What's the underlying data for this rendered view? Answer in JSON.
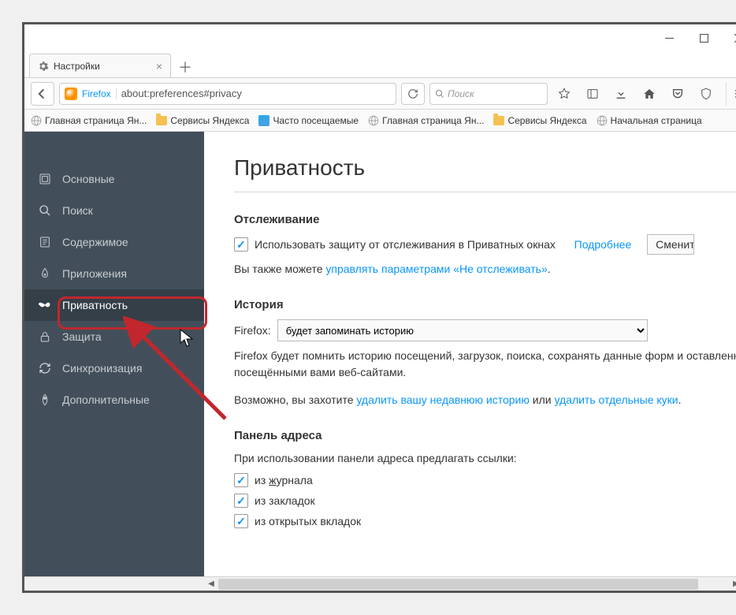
{
  "window": {
    "tab_title": "Настройки"
  },
  "toolbar": {
    "firefox_label": "Firefox",
    "url": "about:preferences#privacy",
    "search_placeholder": "Поиск"
  },
  "bookmarks": [
    {
      "icon": "globe",
      "label": "Главная страница Ян..."
    },
    {
      "icon": "folder",
      "label": "Сервисы Яндекса"
    },
    {
      "icon": "mft",
      "label": "Часто посещаемые"
    },
    {
      "icon": "globe",
      "label": "Главная страница Ян..."
    },
    {
      "icon": "folder",
      "label": "Сервисы Яндекса"
    },
    {
      "icon": "globe",
      "label": "Начальная страница"
    }
  ],
  "sidebar": {
    "items": [
      {
        "label": "Основные"
      },
      {
        "label": "Поиск"
      },
      {
        "label": "Содержимое"
      },
      {
        "label": "Приложения"
      },
      {
        "label": "Приватность"
      },
      {
        "label": "Защита"
      },
      {
        "label": "Синхронизация"
      },
      {
        "label": "Дополнительные"
      }
    ]
  },
  "page": {
    "title": "Приватность",
    "tracking": {
      "heading": "Отслеживание",
      "checkbox_label": "Использовать защиту от отслеживания в Приватных окнах",
      "more_link": "Подробнее",
      "change_button": "Сменить список блокировки",
      "dnt_prefix": "Вы также можете ",
      "dnt_link": "управлять параметрами «Не отслеживать»",
      "dnt_suffix": "."
    },
    "history": {
      "heading": "История",
      "label": "Firefox:",
      "select_value": "будет запоминать историю",
      "desc": "Firefox будет помнить историю посещений, загрузок, поиска, сохранять данные форм и оставленные посещёнными вами веб-сайтами.",
      "maybe_prefix": "Возможно, вы захотите ",
      "link1": "удалить вашу недавнюю историю",
      "middle": " или ",
      "link2": "удалить отдельные куки",
      "suffix": "."
    },
    "address": {
      "heading": "Панель адреса",
      "desc": "При использовании панели адреса предлагать ссылки:",
      "opt1_pre": "из ",
      "opt1_u": "ж",
      "opt1_post": "урнала",
      "opt2": "из закладок",
      "opt3": "из открытых вкладок"
    }
  }
}
